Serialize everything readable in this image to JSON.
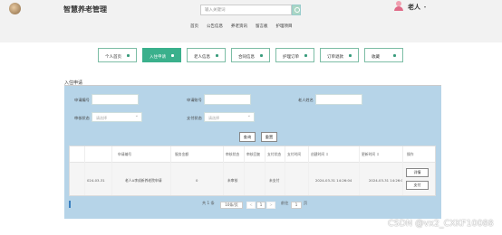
{
  "header": {
    "app_title": "智慧养老管理",
    "search_placeholder": "输入关键词",
    "user_name": "老人",
    "nav": [
      "首页",
      "公告信息",
      "养老资讯",
      "留言板",
      "护理项目"
    ]
  },
  "cards": [
    {
      "label": "个人首页",
      "active": false
    },
    {
      "label": "入住申请",
      "active": true
    },
    {
      "label": "老人信息",
      "active": false
    },
    {
      "label": "合同信息",
      "active": false
    },
    {
      "label": "护理订单",
      "active": false
    },
    {
      "label": "订单退款",
      "active": false
    },
    {
      "label": "收藏",
      "active": false
    }
  ],
  "section_title": "入住申请",
  "filters": {
    "label_1": "申请编号",
    "label_2": "申请账号",
    "label_3": "老人姓名",
    "label_4": "审核状态",
    "select_4": "请选择",
    "label_5": "支付状态",
    "select_5": "请选择",
    "search_btn": "查询",
    "reset_btn": "重置"
  },
  "table": {
    "headers": [
      "",
      "",
      "申请编号",
      "服务金额",
      "审核状态",
      "审核回复",
      "支付状态",
      "支付时间",
      "创建时间 ↕",
      "更新时间 ↕",
      "操作"
    ],
    "rows": [
      {
        "c1": "",
        "c2": "024-03-31",
        "c3": "老人A李成新养老院申请",
        "c4": "0",
        "c5": "未审核",
        "c6": "",
        "c7": "未支付",
        "c8": "",
        "c9": "2024-03-31 14:26:04",
        "c10": "2024-03-31 14:26:04",
        "btn_detail": "详情",
        "btn_pay": "支付"
      }
    ]
  },
  "pager": {
    "total": "共 1 条",
    "page_size": "10条/页",
    "prev": "<",
    "current": "1",
    "next": ">",
    "goto_label": "前往",
    "goto_value": "1",
    "page_suffix": "页"
  },
  "watermark": "CSDN @vx2_CXKF10088"
}
